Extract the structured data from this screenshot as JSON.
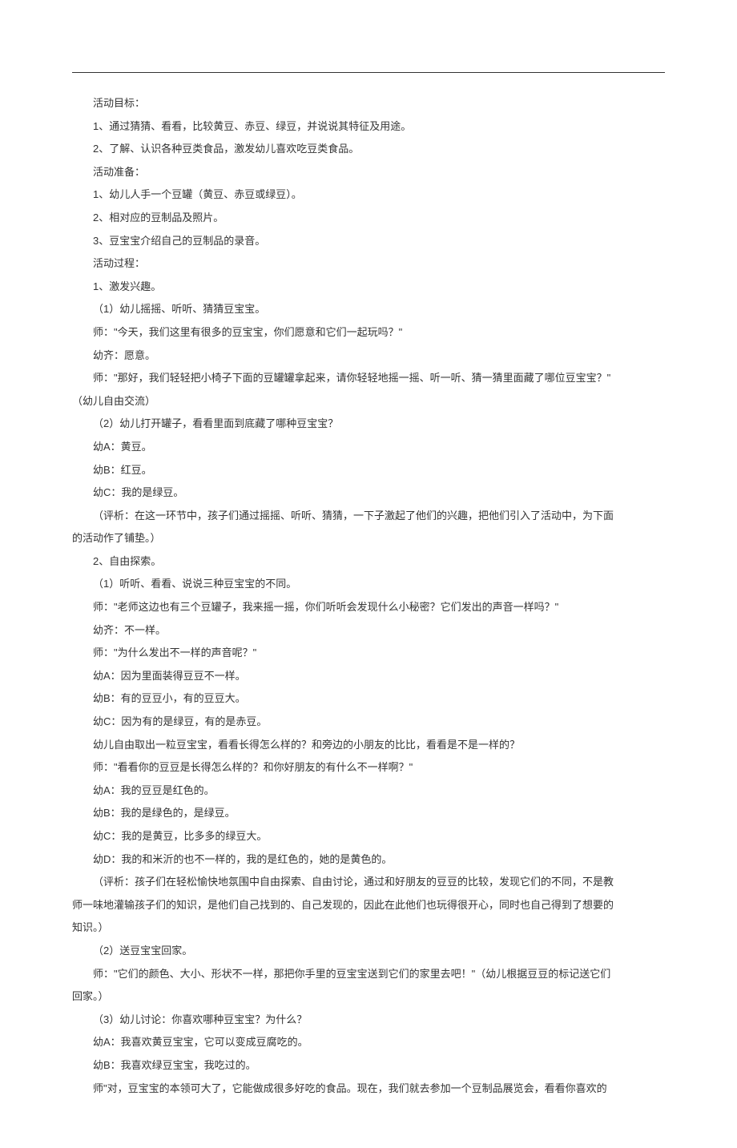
{
  "lines": [
    {
      "indent": true,
      "text": "活动目标："
    },
    {
      "indent": true,
      "text": "1、通过猜猜、看看，比较黄豆、赤豆、绿豆，并说说其特征及用途。"
    },
    {
      "indent": true,
      "text": "2、了解、认识各种豆类食品，激发幼儿喜欢吃豆类食品。"
    },
    {
      "indent": true,
      "text": "活动准备："
    },
    {
      "indent": true,
      "text": "1、幼儿人手一个豆罐（黄豆、赤豆或绿豆）。"
    },
    {
      "indent": true,
      "text": "2、相对应的豆制品及照片。"
    },
    {
      "indent": true,
      "text": "3、豆宝宝介绍自己的豆制品的录音。"
    },
    {
      "indent": true,
      "text": "活动过程："
    },
    {
      "indent": true,
      "text": "1、激发兴趣。"
    },
    {
      "indent": true,
      "text": "（1）幼儿摇摇、听听、猜猜豆宝宝。"
    },
    {
      "indent": true,
      "text": "师：\"今天，我们这里有很多的豆宝宝，你们愿意和它们一起玩吗？\""
    },
    {
      "indent": true,
      "text": "幼齐：愿意。"
    },
    {
      "indent": true,
      "text": "师：\"那好，我们轻轻把小椅子下面的豆罐罐拿起来，请你轻轻地摇一摇、听一听、猜一猜里面藏了哪位豆宝宝？\""
    },
    {
      "indent": false,
      "text": "（幼儿自由交流）"
    },
    {
      "indent": true,
      "text": "（2）幼儿打开罐子，看看里面到底藏了哪种豆宝宝？"
    },
    {
      "indent": true,
      "text": "幼A：黄豆。"
    },
    {
      "indent": true,
      "text": "幼B：红豆。"
    },
    {
      "indent": true,
      "text": "幼C：我的是绿豆。"
    },
    {
      "indent": true,
      "text": "（评析：在这一环节中，孩子们通过摇摇、听听、猜猜，一下子激起了他们的兴趣，把他们引入了活动中，为下面"
    },
    {
      "indent": false,
      "text": "的活动作了铺垫。）"
    },
    {
      "indent": true,
      "text": "2、自由探索。"
    },
    {
      "indent": true,
      "text": "（1）听听、看看、说说三种豆宝宝的不同。"
    },
    {
      "indent": true,
      "text": "师：\"老师这边也有三个豆罐子，我来摇一摇，你们听听会发现什么小秘密？它们发出的声音一样吗？\""
    },
    {
      "indent": true,
      "text": "幼齐：不一样。"
    },
    {
      "indent": true,
      "text": "师：\"为什么发出不一样的声音呢？\""
    },
    {
      "indent": true,
      "text": "幼A：因为里面装得豆豆不一样。"
    },
    {
      "indent": true,
      "text": "幼B：有的豆豆小，有的豆豆大。"
    },
    {
      "indent": true,
      "text": "幼C：因为有的是绿豆，有的是赤豆。"
    },
    {
      "indent": true,
      "text": "幼儿自由取出一粒豆宝宝，看看长得怎么样的？和旁边的小朋友的比比，看看是不是一样的？"
    },
    {
      "indent": true,
      "text": "师：\"看看你的豆豆是长得怎么样的？和你好朋友的有什么不一样啊？\""
    },
    {
      "indent": true,
      "text": "幼A：我的豆豆是红色的。"
    },
    {
      "indent": true,
      "text": "幼B：我的是绿色的，是绿豆。"
    },
    {
      "indent": true,
      "text": "幼C：我的是黄豆，比多多的绿豆大。"
    },
    {
      "indent": true,
      "text": "幼D：我的和米沂的也不一样的，我的是红色的，她的是黄色的。"
    },
    {
      "indent": true,
      "text": "（评析：孩子们在轻松愉快地氛围中自由探索、自由讨论，通过和好朋友的豆豆的比较，发现它们的不同，不是教"
    },
    {
      "indent": false,
      "text": "师一味地灌输孩子们的知识，是他们自己找到的、自己发现的，因此在此他们也玩得很开心，同时也自己得到了想要的"
    },
    {
      "indent": false,
      "text": "知识。）"
    },
    {
      "indent": true,
      "text": "（2）送豆宝宝回家。"
    },
    {
      "indent": true,
      "text": "师：\"它们的颜色、大小、形状不一样，那把你手里的豆宝宝送到它们的家里去吧！\"（幼儿根据豆豆的标记送它们"
    },
    {
      "indent": false,
      "text": "回家。）"
    },
    {
      "indent": true,
      "text": "（3）幼儿讨论：你喜欢哪种豆宝宝？为什么？"
    },
    {
      "indent": true,
      "text": "幼A：我喜欢黄豆宝宝，它可以变成豆腐吃的。"
    },
    {
      "indent": true,
      "text": "幼B：我喜欢绿豆宝宝，我吃过的。"
    },
    {
      "indent": true,
      "text": "师\"对，豆宝宝的本领可大了，它能做成很多好吃的食品。现在，我们就去参加一个豆制品展览会，看看你喜欢的"
    }
  ]
}
